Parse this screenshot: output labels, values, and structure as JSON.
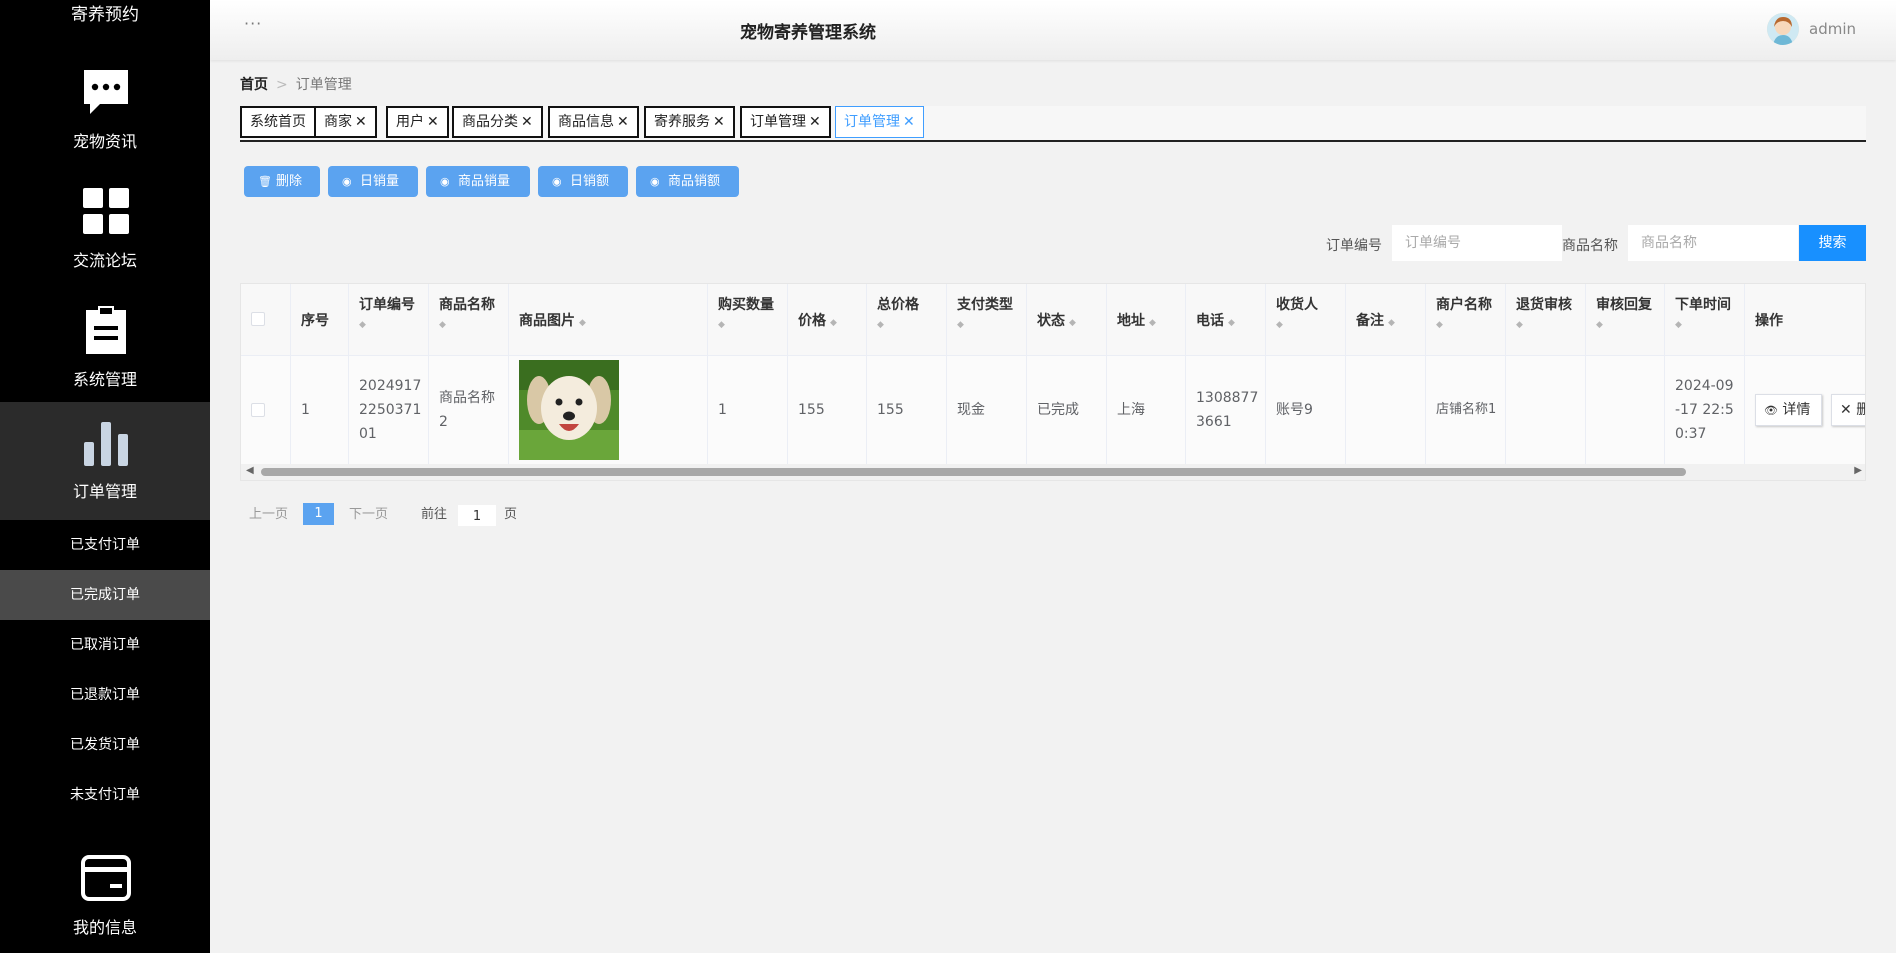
{
  "sidebar": {
    "top_item": "寄养预约",
    "menus": [
      {
        "label": "宠物资讯",
        "icon": "chat-bubble-icon"
      },
      {
        "label": "交流论坛",
        "icon": "grid-icon"
      },
      {
        "label": "系统管理",
        "icon": "clipboard-icon"
      },
      {
        "label": "订单管理",
        "icon": "bar-chart-icon"
      }
    ],
    "sub_items": [
      "已支付订单",
      "已完成订单",
      "已取消订单",
      "已退款订单",
      "已发货订单",
      "未支付订单"
    ],
    "active_sub": "已完成订单",
    "bottom_menu": {
      "label": "我的信息",
      "icon": "card-icon"
    }
  },
  "header": {
    "menu_dots": "···",
    "title": "宠物寄养管理系统",
    "username": "admin"
  },
  "breadcrumb": {
    "home": "首页",
    "separator": ">",
    "current": "订单管理"
  },
  "tabs": [
    {
      "label": "系统首页",
      "closable": false
    },
    {
      "label": "商家",
      "closable": true
    },
    {
      "label": "用户",
      "closable": true
    },
    {
      "label": "商品分类",
      "closable": true
    },
    {
      "label": "商品信息",
      "closable": true
    },
    {
      "label": "寄养服务",
      "closable": true
    },
    {
      "label": "订单管理",
      "closable": true
    },
    {
      "label": "订单管理",
      "closable": true,
      "active": true
    }
  ],
  "close_glyph": "✕",
  "toolbar": {
    "delete": "删除",
    "daily_sales": "日销量",
    "product_sales": "商品销量",
    "daily_revenue": "日销额",
    "product_revenue": "商品销额"
  },
  "search": {
    "order_no_label": "订单编号",
    "order_no_placeholder": "订单编号",
    "product_name_label": "商品名称",
    "product_name_placeholder": "商品名称",
    "button": "搜索"
  },
  "table": {
    "columns": [
      "序号",
      "订单编号",
      "商品名称",
      "商品图片",
      "购买数量",
      "价格",
      "总价格",
      "支付类型",
      "状态",
      "地址",
      "电话",
      "收货人",
      "备注",
      "商户名称",
      "退货审核",
      "审核回复",
      "下单时间",
      "操作"
    ],
    "rows": [
      {
        "index": "1",
        "order_no": "2024917225037101",
        "product_name": "商品名称2",
        "image": "puppy-photo",
        "quantity": "1",
        "price": "155",
        "total": "155",
        "pay_type": "现金",
        "status": "已完成",
        "address": "上海",
        "phone": "13088773661",
        "receiver": "账号9",
        "remark": "",
        "merchant": "店铺名称1",
        "return_review": "",
        "review_reply": "",
        "order_time": "2024-09-17 22:50:37",
        "actions": {
          "detail": "详情",
          "delete": "删除"
        }
      }
    ]
  },
  "pagination": {
    "prev": "上一页",
    "current": "1",
    "next": "下一页",
    "goto_prefix": "前往",
    "goto_value": "1",
    "goto_suffix": "页"
  }
}
